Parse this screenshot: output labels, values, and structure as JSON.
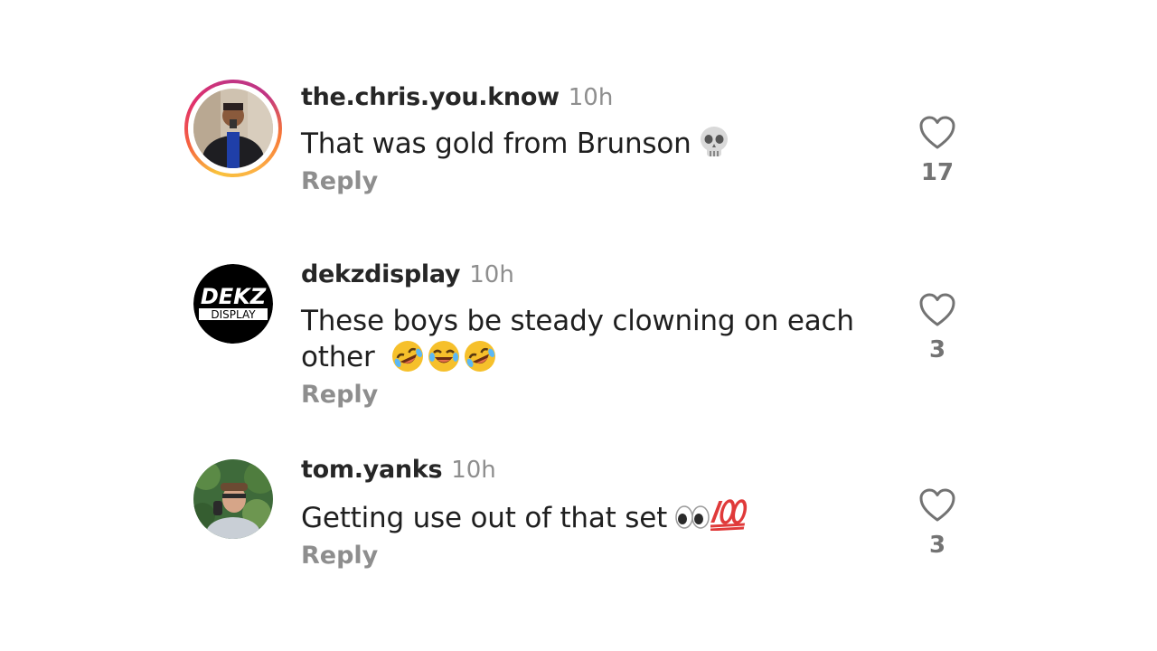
{
  "comments": [
    {
      "username": "the.chris.you.know",
      "time": "10h",
      "text": "That was gold from Brunson",
      "emoji": [
        "skull-icon"
      ],
      "reply_label": "Reply",
      "likes": "17",
      "has_story_ring": true
    },
    {
      "username": "dekzdisplay",
      "time": "10h",
      "text_line1": "These boys be steady clowning on each",
      "text_line2": "other",
      "emoji": [
        "rolling-laughing-icon",
        "tears-of-joy-icon",
        "rolling-laughing-icon"
      ],
      "reply_label": "Reply",
      "likes": "3",
      "avatar_logo_top": "DEKZ",
      "avatar_logo_bottom": "DISPLAY"
    },
    {
      "username": "tom.yanks",
      "time": "10h",
      "text": "Getting use out of that set",
      "emoji": [
        "eyes-icon",
        "hundred-points-icon"
      ],
      "reply_label": "Reply",
      "likes": "3"
    }
  ],
  "colors": {
    "text": "#1f1f1f",
    "muted": "#8e8e8e",
    "story_ring_start": "#f9c23c",
    "story_ring_end": "#c13584"
  }
}
